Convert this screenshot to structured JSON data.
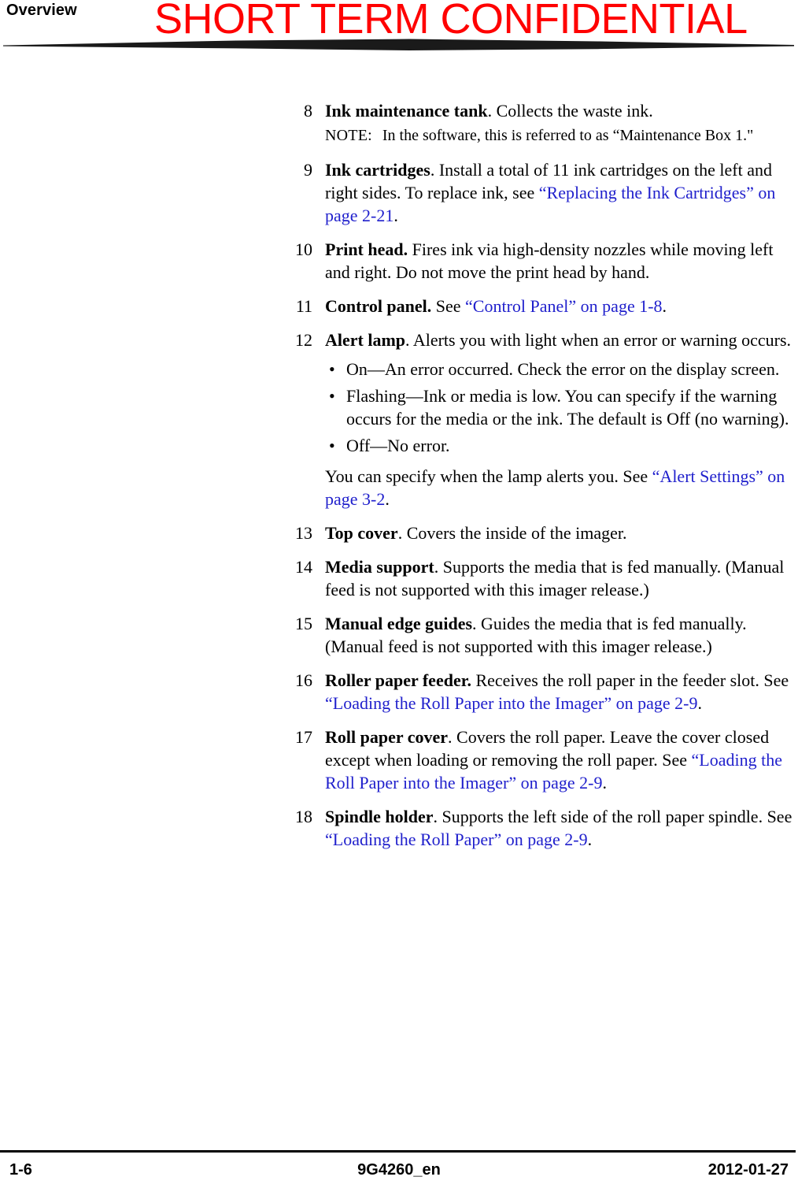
{
  "header": {
    "running_title": "Overview",
    "watermark": "SHORT TERM CONFIDENTIAL",
    "watermark_color": "#ff0000"
  },
  "colors": {
    "text": "#000000",
    "cross_reference": "#1f1fcc",
    "rule": "#1a1a1a"
  },
  "items": [
    {
      "num": "8",
      "lead": "Ink maintenance tank",
      "rest": ". Collects the waste ink.",
      "note_label": "NOTE:",
      "note_text": "In the software, this is referred to as “Maintenance Box 1.\""
    },
    {
      "num": "9",
      "lead": "Ink cartridges",
      "rest": ". Install a total of 11 ink cartridges on the left and right sides. To replace ink, see ",
      "xref": "“Replacing the Ink Cartridges” on page 2-21",
      "tail": "."
    },
    {
      "num": "10",
      "lead": "Print head.",
      "rest": " Fires ink via high-density nozzles while moving left and right. Do not move the print head by hand."
    },
    {
      "num": "11",
      "lead": "Control panel.",
      "rest": " See ",
      "xref": "“Control Panel” on page 1-8",
      "tail": "."
    },
    {
      "num": "12",
      "lead": "Alert lamp",
      "rest": ". Alerts you with light when an error or warning occurs.",
      "bullets": [
        "On—An error occurred. Check the error on the display screen.",
        "Flashing—Ink or media is low. You can specify if the warning occurs for the media or the ink. The default is Off (no warning).",
        "Off—No error."
      ],
      "sub_para_pre": "You can specify when the lamp alerts you. See ",
      "sub_para_xref": "“Alert Settings” on page 3-2",
      "sub_para_tail": "."
    },
    {
      "num": "13",
      "lead": "Top cover",
      "rest": ". Covers the inside of the imager."
    },
    {
      "num": "14",
      "lead": "Media support",
      "rest": ". Supports the media that is fed manually. (Manual feed is not supported with this imager release.)"
    },
    {
      "num": "15",
      "lead": "Manual edge guides",
      "rest": ". Guides the media that is fed manually. (Manual feed is not supported with this imager release.)"
    },
    {
      "num": "16",
      "lead": "Roller paper feeder.",
      "rest": " Receives the roll paper in the feeder slot. See ",
      "xref": "“Loading the Roll Paper into the Imager” on page 2-9",
      "tail": "."
    },
    {
      "num": "17",
      "lead": "Roll paper cover",
      "rest": ". Covers the roll paper. Leave the cover closed except when loading or removing the roll paper. See ",
      "xref": "“Loading the Roll Paper into the Imager” on page 2-9",
      "tail": "."
    },
    {
      "num": "18",
      "lead": "Spindle holder",
      "rest": ". Supports the left side of the roll paper spindle. See ",
      "xref": "“Loading the Roll Paper” on page 2-9",
      "tail": "."
    }
  ],
  "footer": {
    "page_number": "1-6",
    "document_id": "9G4260_en",
    "date": "2012-01-27"
  }
}
